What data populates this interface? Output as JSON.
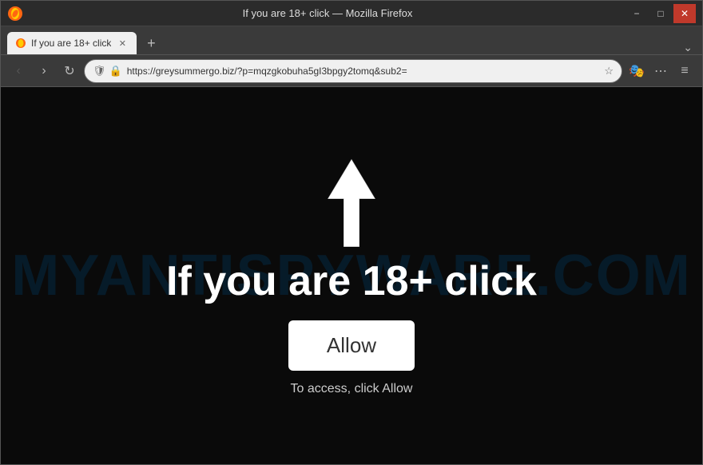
{
  "window": {
    "title": "If you are 18+ click — Mozilla Firefox"
  },
  "titlebar": {
    "title": "If you are 18+ click — Mozilla Firefox",
    "minimize_label": "−",
    "maximize_label": "□",
    "close_label": "✕"
  },
  "tabbar": {
    "tab_label": "If you are 18+ click",
    "tab_close": "✕",
    "new_tab": "+"
  },
  "navbar": {
    "back": "‹",
    "forward": "›",
    "refresh": "↻",
    "url": "https://greysummergo.biz/?p=mqzgkobuha5gI3bpgy2tomq&sub2=",
    "bookmark_icon": "☆",
    "extensions_icon": "⋯",
    "menu_icon": "≡"
  },
  "webpage": {
    "watermark_line1": "MYANTISPYWARE.COM",
    "heading": "If you are 18+ click",
    "allow_button": "Allow",
    "subtext": "To access, click Allow"
  }
}
